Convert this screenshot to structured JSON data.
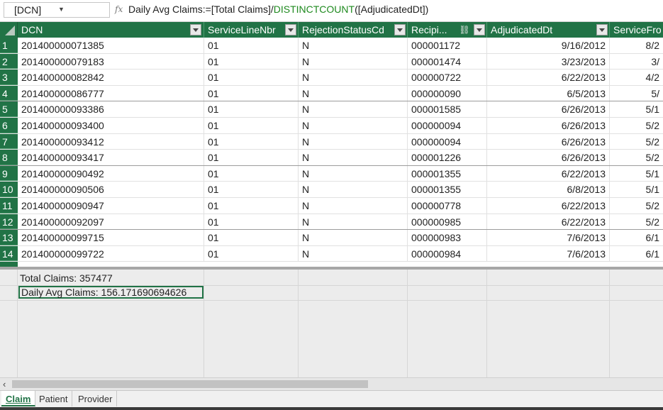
{
  "formula_bar": {
    "name_box": "[DCN]",
    "fx_label": "fx",
    "formula_prefix": "Daily Avg Claims:=[Total Claims]/",
    "formula_function": "DISTINCTCOUNT",
    "formula_suffix": "([AdjudicatedDt])"
  },
  "columns": [
    "DCN",
    "ServiceLineNbr",
    "RejectionStatusCd",
    "Recipi...",
    "AdjudicatedDt",
    "ServiceFro"
  ],
  "rows": [
    {
      "n": "1",
      "dcn": "201400000071385",
      "sln": "01",
      "rej": "N",
      "rec": "000001172",
      "adj": "9/16/2012",
      "svc": "8/2"
    },
    {
      "n": "2",
      "dcn": "201400000079183",
      "sln": "01",
      "rej": "N",
      "rec": "000001474",
      "adj": "3/23/2013",
      "svc": "3/"
    },
    {
      "n": "3",
      "dcn": "201400000082842",
      "sln": "01",
      "rej": "N",
      "rec": "000000722",
      "adj": "6/22/2013",
      "svc": "4/2"
    },
    {
      "n": "4",
      "dcn": "201400000086777",
      "sln": "01",
      "rej": "N",
      "rec": "000000090",
      "adj": "6/5/2013",
      "svc": "5/"
    },
    {
      "n": "5",
      "dcn": "201400000093386",
      "sln": "01",
      "rej": "N",
      "rec": "000001585",
      "adj": "6/26/2013",
      "svc": "5/1"
    },
    {
      "n": "6",
      "dcn": "201400000093400",
      "sln": "01",
      "rej": "N",
      "rec": "000000094",
      "adj": "6/26/2013",
      "svc": "5/2"
    },
    {
      "n": "7",
      "dcn": "201400000093412",
      "sln": "01",
      "rej": "N",
      "rec": "000000094",
      "adj": "6/26/2013",
      "svc": "5/2"
    },
    {
      "n": "8",
      "dcn": "201400000093417",
      "sln": "01",
      "rej": "N",
      "rec": "000001226",
      "adj": "6/26/2013",
      "svc": "5/2"
    },
    {
      "n": "9",
      "dcn": "201400000090492",
      "sln": "01",
      "rej": "N",
      "rec": "000001355",
      "adj": "6/22/2013",
      "svc": "5/1"
    },
    {
      "n": "10",
      "dcn": "201400000090506",
      "sln": "01",
      "rej": "N",
      "rec": "000001355",
      "adj": "6/8/2013",
      "svc": "5/1"
    },
    {
      "n": "11",
      "dcn": "201400000090947",
      "sln": "01",
      "rej": "N",
      "rec": "000000778",
      "adj": "6/22/2013",
      "svc": "5/2"
    },
    {
      "n": "12",
      "dcn": "201400000092097",
      "sln": "01",
      "rej": "N",
      "rec": "000000985",
      "adj": "6/22/2013",
      "svc": "5/2"
    },
    {
      "n": "13",
      "dcn": "201400000099715",
      "sln": "01",
      "rej": "N",
      "rec": "000000983",
      "adj": "7/6/2013",
      "svc": "6/1"
    },
    {
      "n": "14",
      "dcn": "201400000099722",
      "sln": "01",
      "rej": "N",
      "rec": "000000984",
      "adj": "7/6/2013",
      "svc": "6/1"
    }
  ],
  "measures": {
    "total_claims": "Total Claims: 357477",
    "daily_avg_claims": "Daily Avg Claims: 156.171690694626"
  },
  "tabs": [
    "Claim",
    "Patient",
    "Provider"
  ],
  "colors": {
    "header": "#217346",
    "calc_area": "#ececec"
  }
}
